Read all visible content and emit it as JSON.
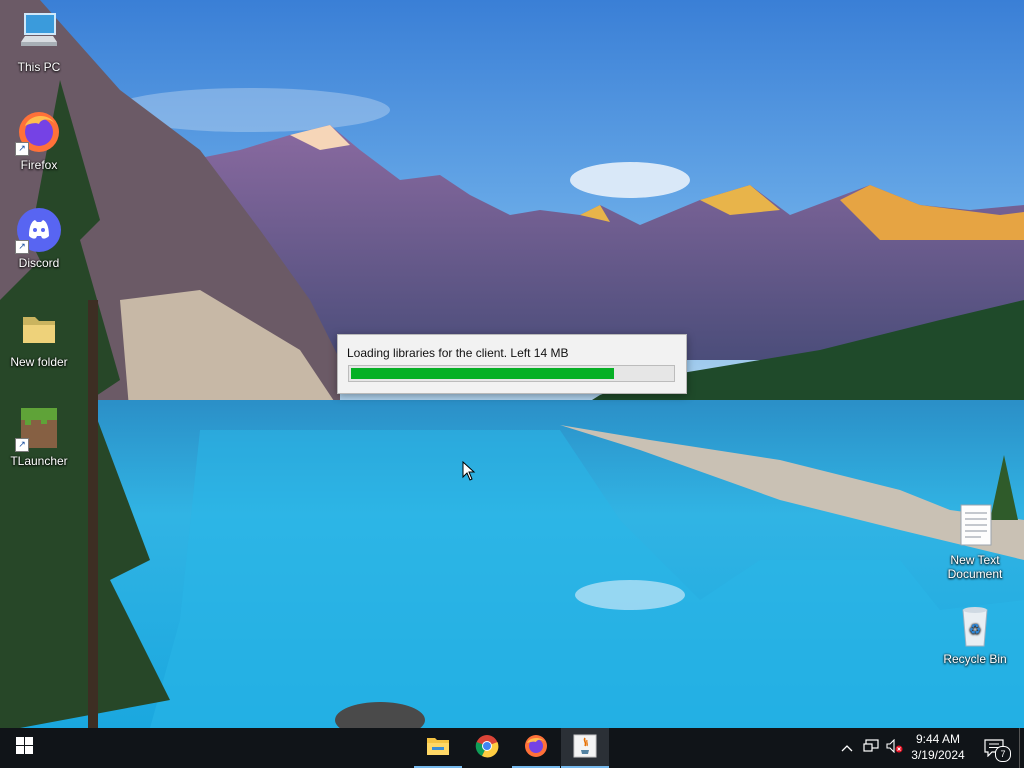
{
  "desktop": {
    "icons": [
      {
        "label": "This PC",
        "icon": "computer-icon"
      },
      {
        "label": "Firefox",
        "icon": "firefox-icon"
      },
      {
        "label": "Discord",
        "icon": "discord-icon"
      },
      {
        "label": "New folder",
        "icon": "folder-icon"
      },
      {
        "label": "TLauncher",
        "icon": "grass-block-icon"
      },
      {
        "label": "New Text Document",
        "label_line1": "New Text",
        "label_line2": "Document",
        "icon": "text-document-icon"
      },
      {
        "label": "Recycle Bin",
        "icon": "recycle-bin-icon"
      }
    ]
  },
  "dialog": {
    "message": "Loading libraries for the client. Left 14 MB",
    "progress": 0.82,
    "progress_color": "#06b025"
  },
  "taskbar": {
    "apps": [
      {
        "name": "File Explorer",
        "icon": "file-explorer-icon",
        "running": true
      },
      {
        "name": "Google Chrome",
        "icon": "chrome-icon",
        "running": false
      },
      {
        "name": "Firefox",
        "icon": "firefox-icon",
        "running": true
      },
      {
        "name": "Java",
        "icon": "java-icon",
        "running": true,
        "focused": true
      }
    ],
    "tray": {
      "icons": [
        "chevron-up-icon",
        "network-icon",
        "volume-muted-icon",
        "notifications-icon"
      ],
      "time": "9:44 AM",
      "date": "3/19/2024",
      "notification_count": "7"
    }
  }
}
